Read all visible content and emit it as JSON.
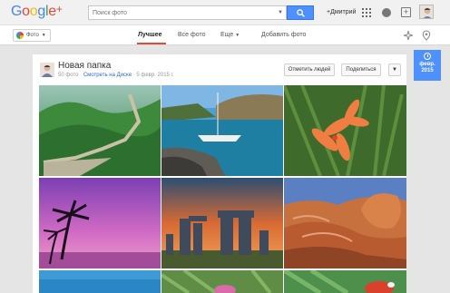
{
  "header": {
    "logo_word": [
      "G",
      "o",
      "o",
      "g",
      "l",
      "e"
    ],
    "logo_plus": "+",
    "search_placeholder": "Поиск фото",
    "user_name": "+Дмитрий"
  },
  "nav": {
    "photos_menu": "Фото",
    "tabs": [
      {
        "label": "Лучшее",
        "active": true
      },
      {
        "label": "Все фото",
        "active": false
      },
      {
        "label": "Еще",
        "active": false
      },
      {
        "label": "Добавить фото",
        "active": false
      }
    ]
  },
  "album": {
    "title": "Новая папка",
    "count": "50 фото",
    "drive_link": "Смотреть на Диске",
    "date": "5 февр. 2015 г.",
    "tag_people": "Отметить людей",
    "share": "Поделиться"
  },
  "date_badge": {
    "month": "февр.",
    "year": "2015"
  },
  "photos": [
    {
      "name": "great-wall"
    },
    {
      "name": "sailboat-bay"
    },
    {
      "name": "orange-lilies"
    },
    {
      "name": "palm-sunset"
    },
    {
      "name": "stonehenge"
    },
    {
      "name": "sandstone-rocks"
    },
    {
      "name": "ocean-partial"
    },
    {
      "name": "pink-flower-partial"
    },
    {
      "name": "parrot-partial"
    }
  ],
  "colors": {
    "accent_blue": "#4d90fe",
    "tab_underline": "#dd4b39",
    "link": "#3366cc"
  }
}
